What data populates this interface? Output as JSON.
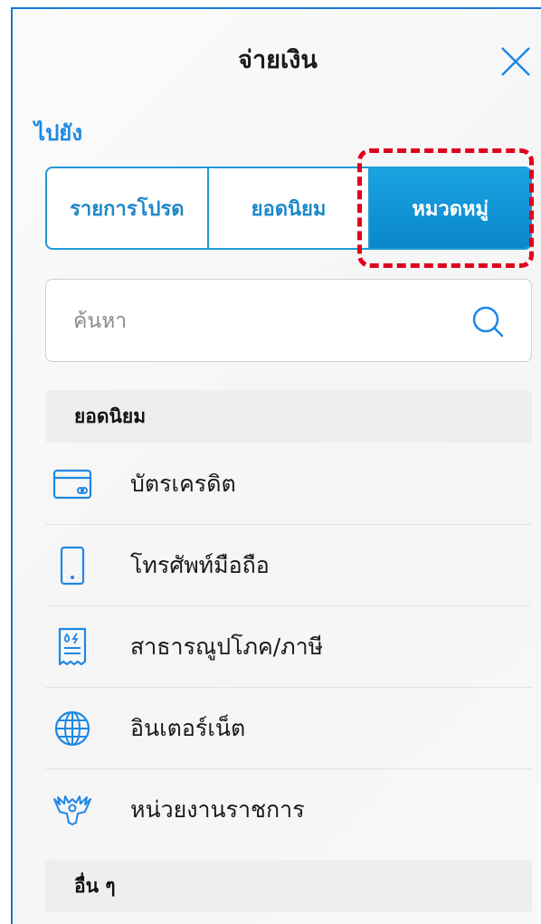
{
  "header": {
    "title": "จ่ายเงิน",
    "close_icon": "close-icon"
  },
  "goto": {
    "label": "ไปยัง"
  },
  "tabs": [
    {
      "label": "รายการโปรด",
      "active": false
    },
    {
      "label": "ยอดนิยม",
      "active": false
    },
    {
      "label": "หมวดหมู่",
      "active": true
    }
  ],
  "search": {
    "placeholder": "ค้นหา",
    "value": "",
    "icon": "search-icon"
  },
  "sections": {
    "popular": {
      "title": "ยอดนิยม",
      "items": [
        {
          "label": "บัตรเครดิต",
          "icon": "credit-card-icon"
        },
        {
          "label": "โทรศัพท์มือถือ",
          "icon": "mobile-phone-icon"
        },
        {
          "label": "สาธารณูปโภค/ภาษี",
          "icon": "utility-bill-icon"
        },
        {
          "label": "อินเตอร์เน็ต",
          "icon": "globe-icon"
        },
        {
          "label": "หน่วยงานราชการ",
          "icon": "government-emblem-icon"
        }
      ]
    },
    "others": {
      "title": "อื่น ๆ"
    }
  },
  "colors": {
    "accent": "#1e88e5",
    "tab_active_bg": "#0a87cc",
    "highlight": "#e0001b"
  }
}
